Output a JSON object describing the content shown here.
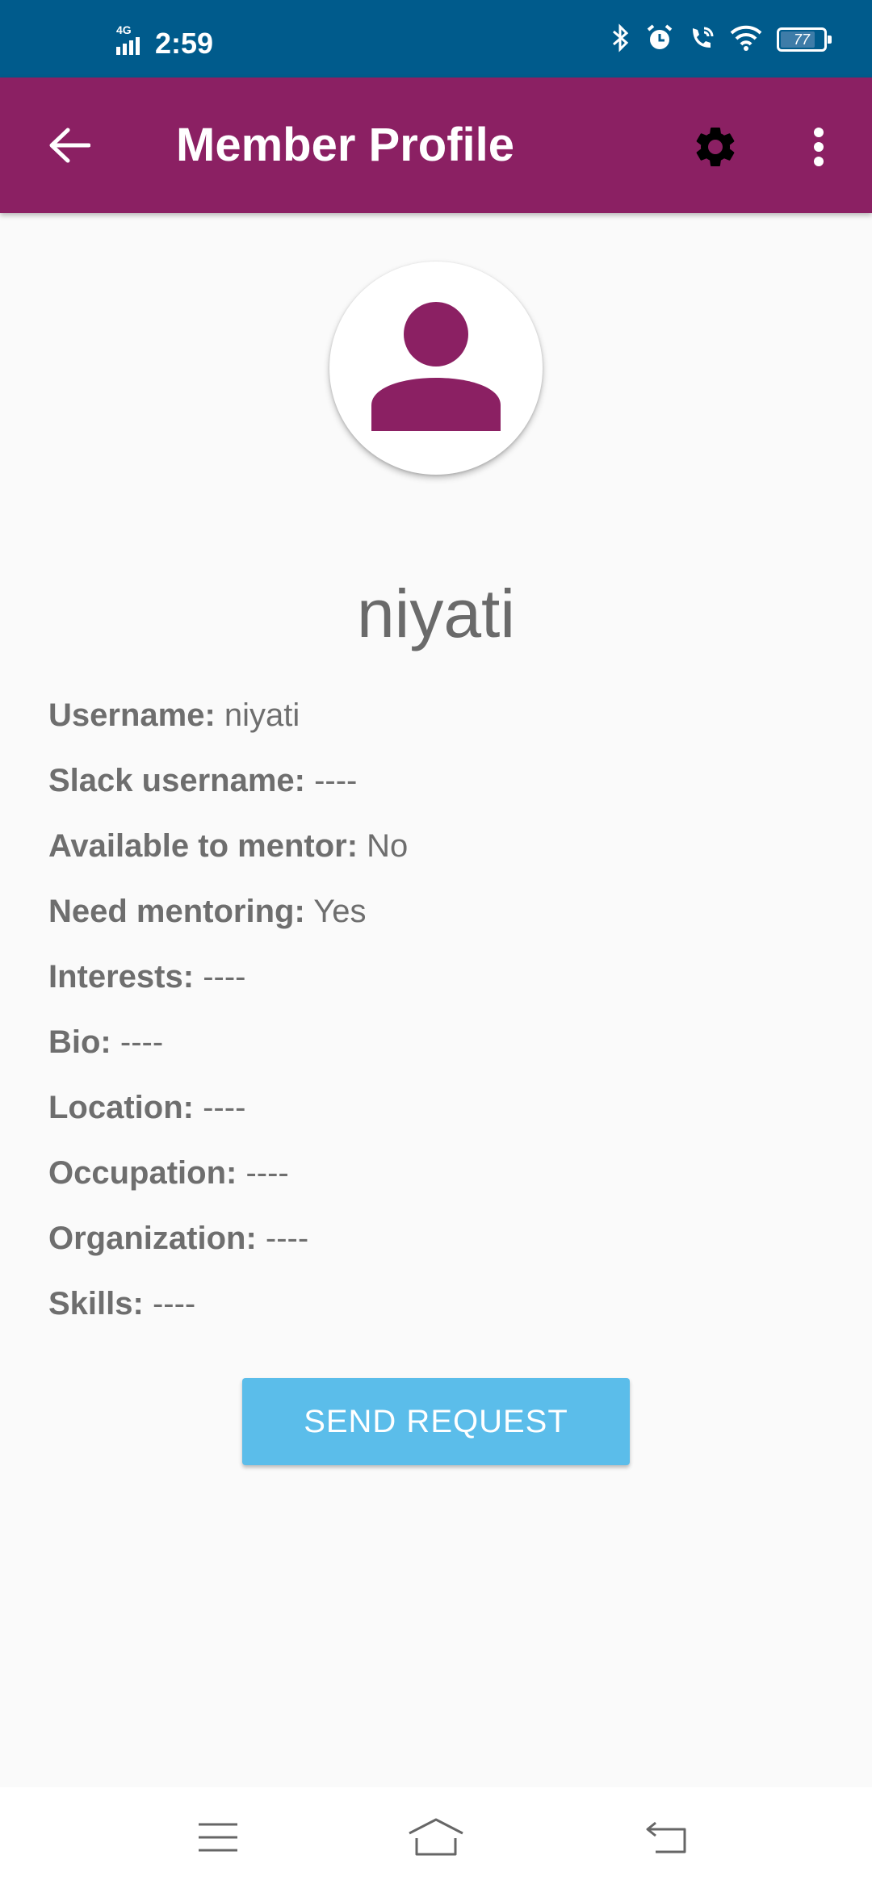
{
  "status_bar": {
    "network": "4G",
    "time": "2:59",
    "battery_level": "77",
    "icons": [
      "bluetooth-icon",
      "alarm-icon",
      "wifi-call-icon",
      "wifi-icon",
      "battery-icon"
    ]
  },
  "app_bar": {
    "title": "Member Profile",
    "icons": [
      "back-arrow-icon",
      "gear-icon",
      "more-vert-icon"
    ]
  },
  "profile": {
    "avatar_icon": "person-icon",
    "display_name": "niyati",
    "fields": [
      {
        "label": "Username:",
        "value": "niyati"
      },
      {
        "label": "Slack username:",
        "value": "----"
      },
      {
        "label": "Available to mentor:",
        "value": "No"
      },
      {
        "label": "Need mentoring:",
        "value": "Yes"
      },
      {
        "label": "Interests:",
        "value": "----"
      },
      {
        "label": "Bio:",
        "value": "----"
      },
      {
        "label": "Location:",
        "value": "----"
      },
      {
        "label": "Occupation:",
        "value": "----"
      },
      {
        "label": "Organization:",
        "value": "----"
      },
      {
        "label": "Skills:",
        "value": "----"
      }
    ],
    "send_button": "SEND REQUEST"
  },
  "nav_bar": {
    "icons": [
      "menu-icon",
      "home-icon",
      "back-icon"
    ]
  },
  "colors": {
    "status_bar": "#005b8c",
    "app_bar": "#8b2063",
    "accent_button": "#5bbdea",
    "avatar_icon": "#8b2063",
    "text": "#6e6e6e"
  }
}
